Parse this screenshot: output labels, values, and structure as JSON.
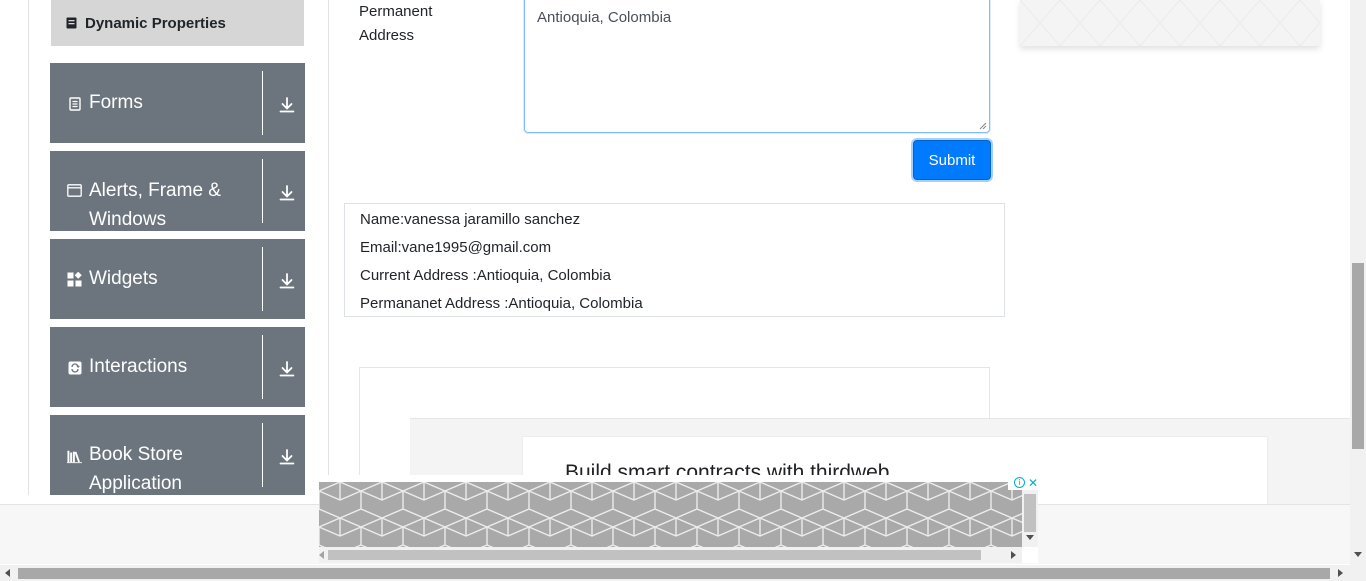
{
  "sidebar": {
    "active_item": {
      "label": "Dynamic Properties",
      "icon": "document-icon"
    },
    "groups": [
      {
        "label": "Forms",
        "icon": "form-icon"
      },
      {
        "label": "Alerts, Frame & Windows",
        "line1": "Alerts, Frame &",
        "line2": "Windows",
        "icon": "window-icon"
      },
      {
        "label": "Widgets",
        "icon": "widgets-icon"
      },
      {
        "label": "Interactions",
        "icon": "interactions-icon"
      },
      {
        "label": "Book Store Application",
        "line1": "Book Store",
        "line2": "Application",
        "icon": "books-icon"
      }
    ]
  },
  "form": {
    "permanent_address_label": "Permanent Address",
    "permanent_address_line1": "Permanent",
    "permanent_address_line2": "Address",
    "permanent_address_value": "Antioquia, Colombia",
    "submit_label": "Submit"
  },
  "output": {
    "name": "Name:vanessa jaramillo sanchez",
    "email": "Email:vane1995@gmail.com",
    "current_address": "Current Address :Antioquia, Colombia",
    "permanent_address": "Permananet Address :Antioquia, Colombia"
  },
  "ad": {
    "headline": "Build smart contracts with thirdweb",
    "close_label": "✕",
    "info_label": "i"
  },
  "colors": {
    "sidebar_group_bg": "#6c757d",
    "active_item_bg": "#d6d6d6",
    "submit_bg": "#007bff"
  }
}
